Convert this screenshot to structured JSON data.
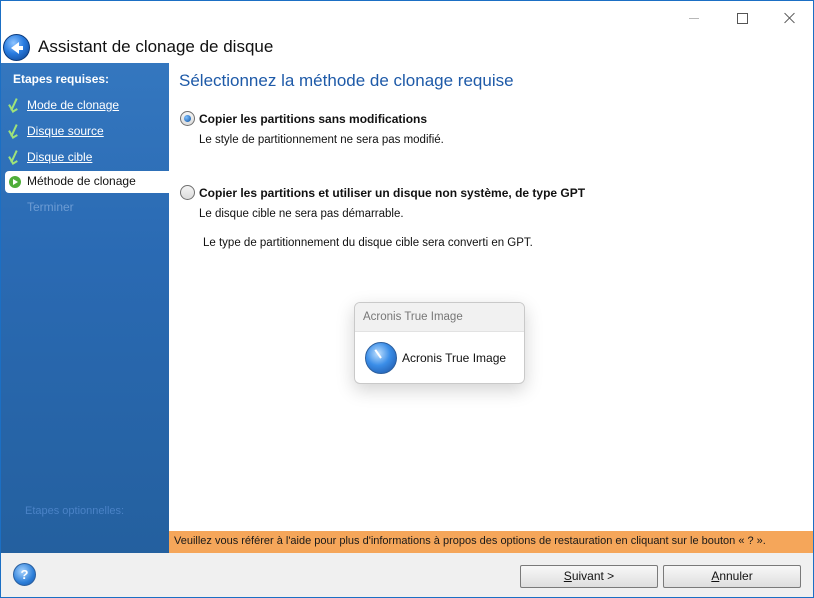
{
  "window": {
    "title": "Assistant de clonage de disque"
  },
  "sidebar": {
    "heading": "Etapes requises:",
    "steps": [
      {
        "label": "Mode de clonage",
        "state": "done"
      },
      {
        "label": "Disque source",
        "state": "done"
      },
      {
        "label": "Disque cible",
        "state": "done"
      },
      {
        "label": "Méthode de clonage",
        "state": "current"
      },
      {
        "label": "Terminer",
        "state": "disabled"
      }
    ],
    "optional_label": "Etapes optionnelles:"
  },
  "main": {
    "title": "Sélectionnez la méthode de clonage requise",
    "options": [
      {
        "label": "Copier les partitions sans modifications",
        "description": "Le style de partitionnement ne sera pas modifié.",
        "selected": true
      },
      {
        "label": "Copier les partitions et utiliser un disque non système, de type GPT",
        "description": "Le disque cible ne sera pas démarrable.",
        "note": "Le type de partitionnement du disque cible sera converti en GPT.",
        "selected": false
      }
    ]
  },
  "popup": {
    "header": "Acronis True Image",
    "app_name": "Acronis True Image"
  },
  "infobar": {
    "text": "Veuillez vous référer à l'aide pour plus d'informations à propos des options de restauration en cliquant sur le bouton « ? »."
  },
  "footer": {
    "help_label": "?",
    "next_prefix": "S",
    "next_rest": "uivant >",
    "cancel_prefix": "A",
    "cancel_rest": "nnuler"
  },
  "colors": {
    "sidebar": "#2a6ab3",
    "title_blue": "#1e5aa8",
    "infobar": "#f5a65a",
    "check": "#9fe27a"
  }
}
